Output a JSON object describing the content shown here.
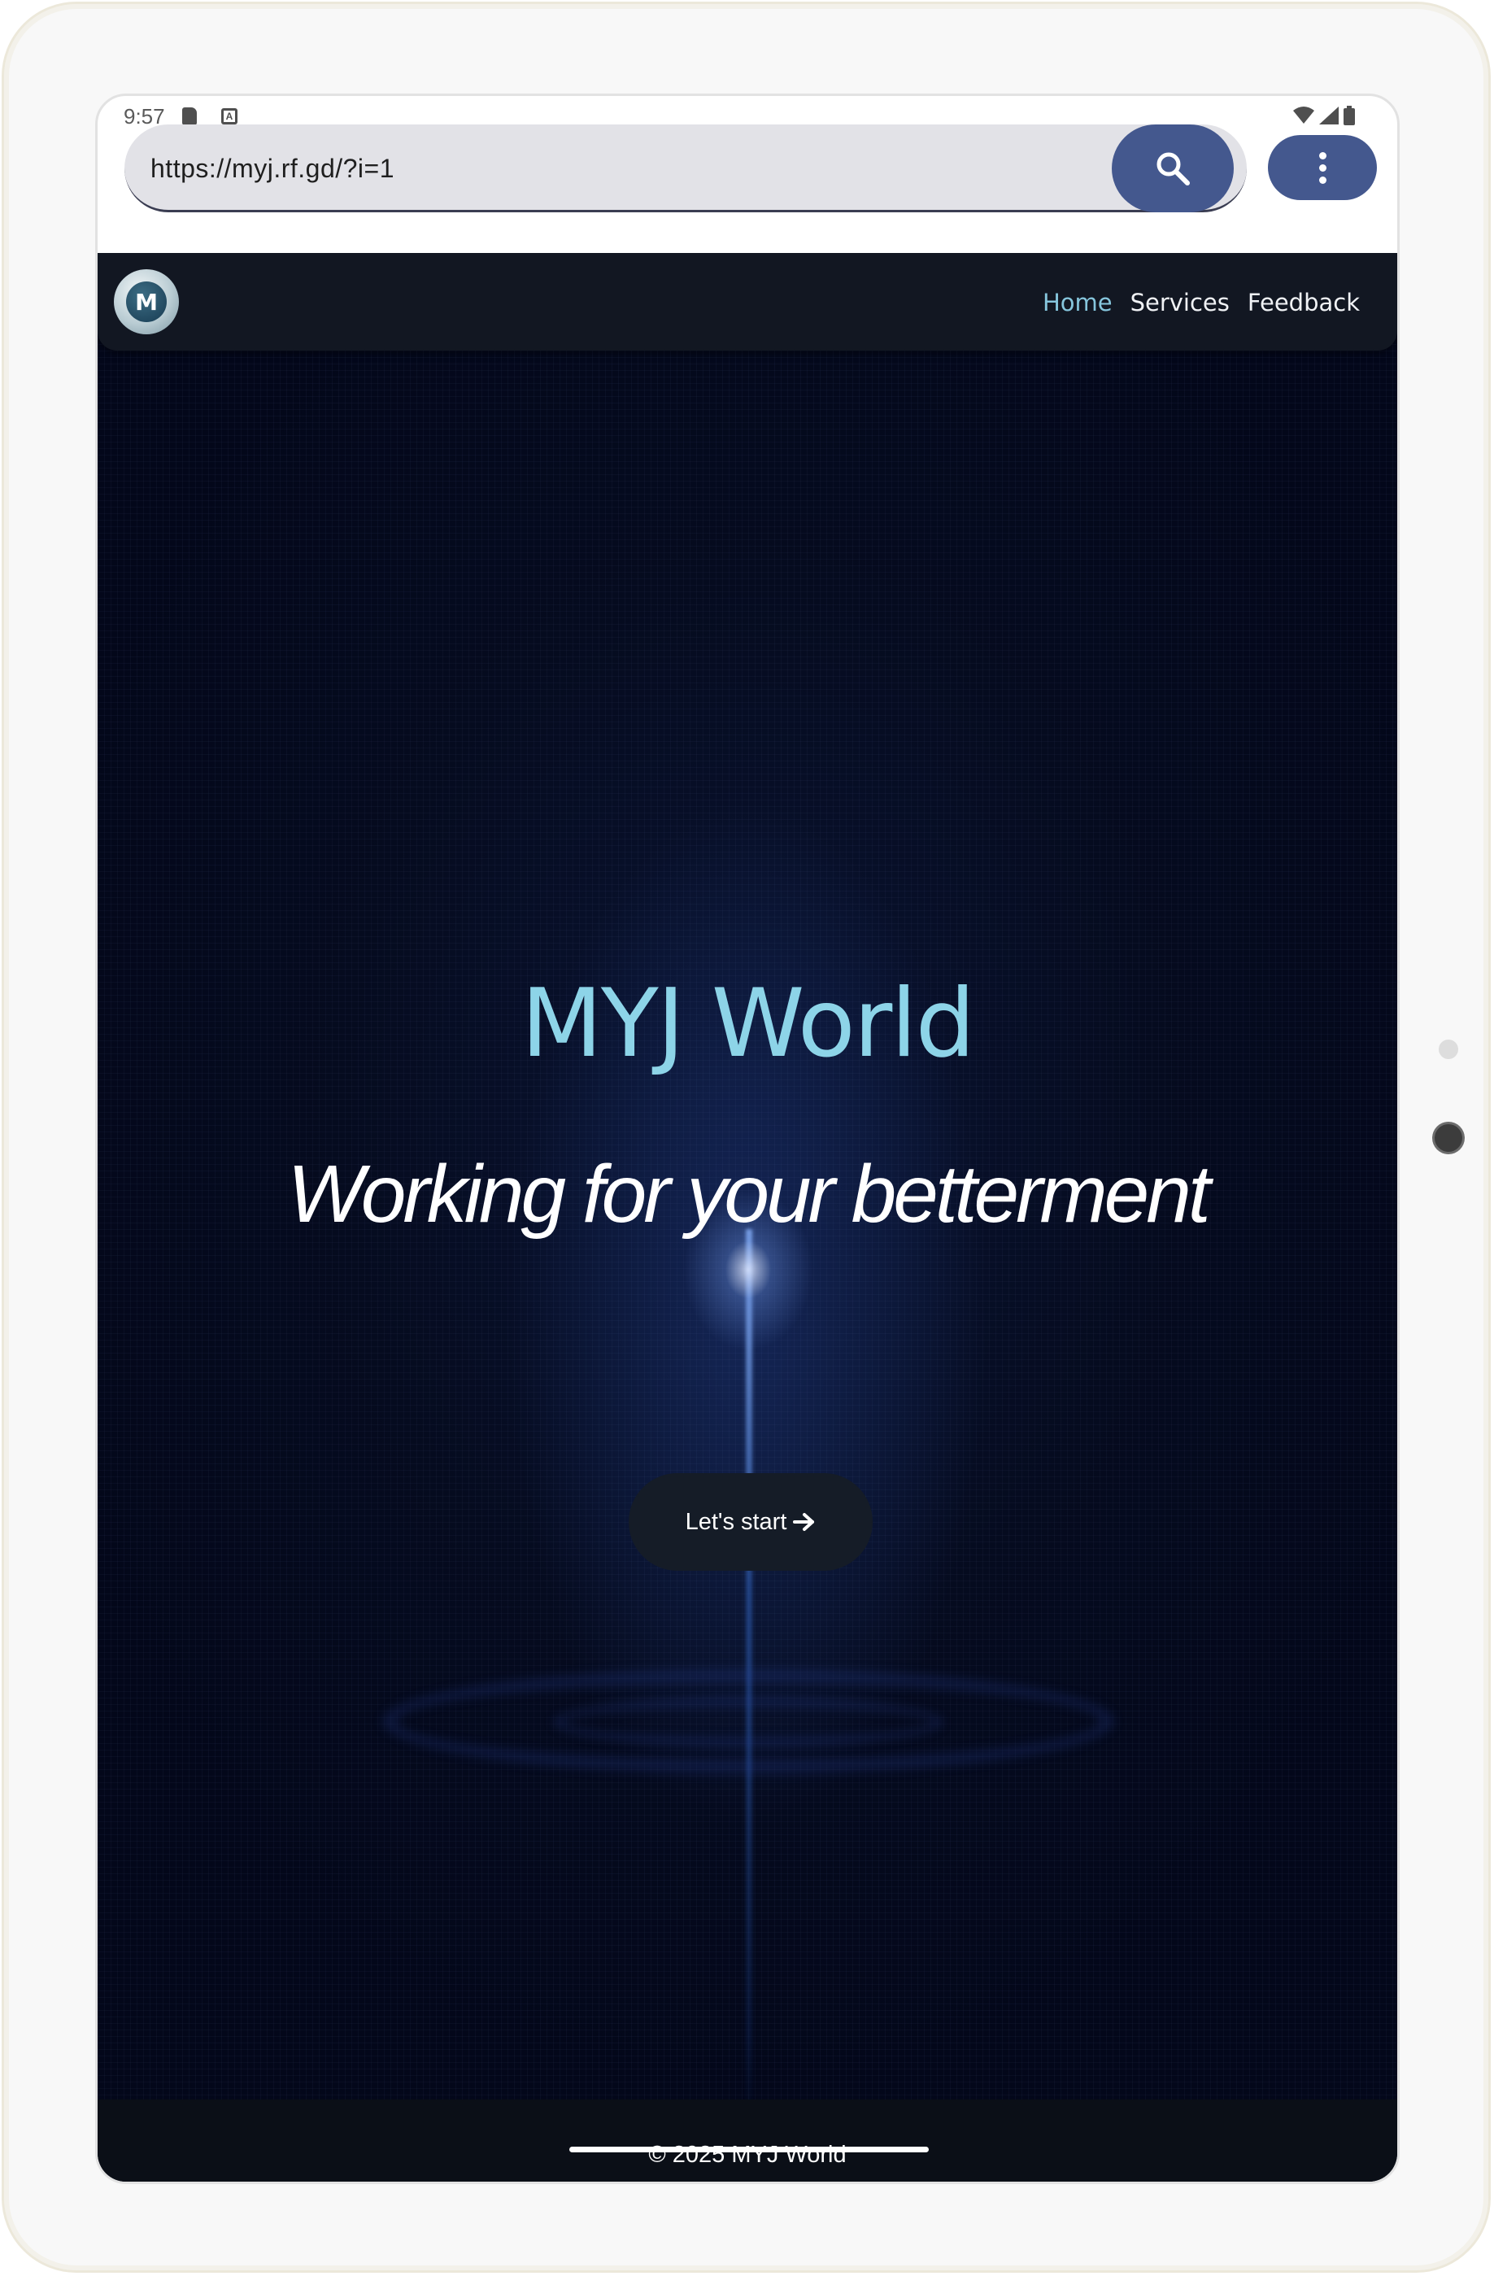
{
  "status_bar": {
    "time": "9:57",
    "icons": [
      "sd-card-icon",
      "a-icon",
      "wifi-icon",
      "signal-icon",
      "battery-icon"
    ]
  },
  "browser": {
    "url": "https://myj.rf.gd/?i=1",
    "search_icon": "search-icon",
    "menu_icon": "more-vert-icon",
    "accent_color": "#44588e"
  },
  "navbar": {
    "logo_letter": "M",
    "links": [
      {
        "label": "Home",
        "active": true
      },
      {
        "label": "Services",
        "active": false
      },
      {
        "label": "Feedback",
        "active": false
      }
    ],
    "active_color": "#86c6dd"
  },
  "hero": {
    "title": "MYJ World",
    "subtitle": "Working for your betterment",
    "cta_label": "Let's start",
    "cta_icon": "arrow-right-icon",
    "title_color": "#8dd4e8",
    "background_color": "#050b1f"
  },
  "footer": {
    "text": "© 2025 MYJ World"
  }
}
